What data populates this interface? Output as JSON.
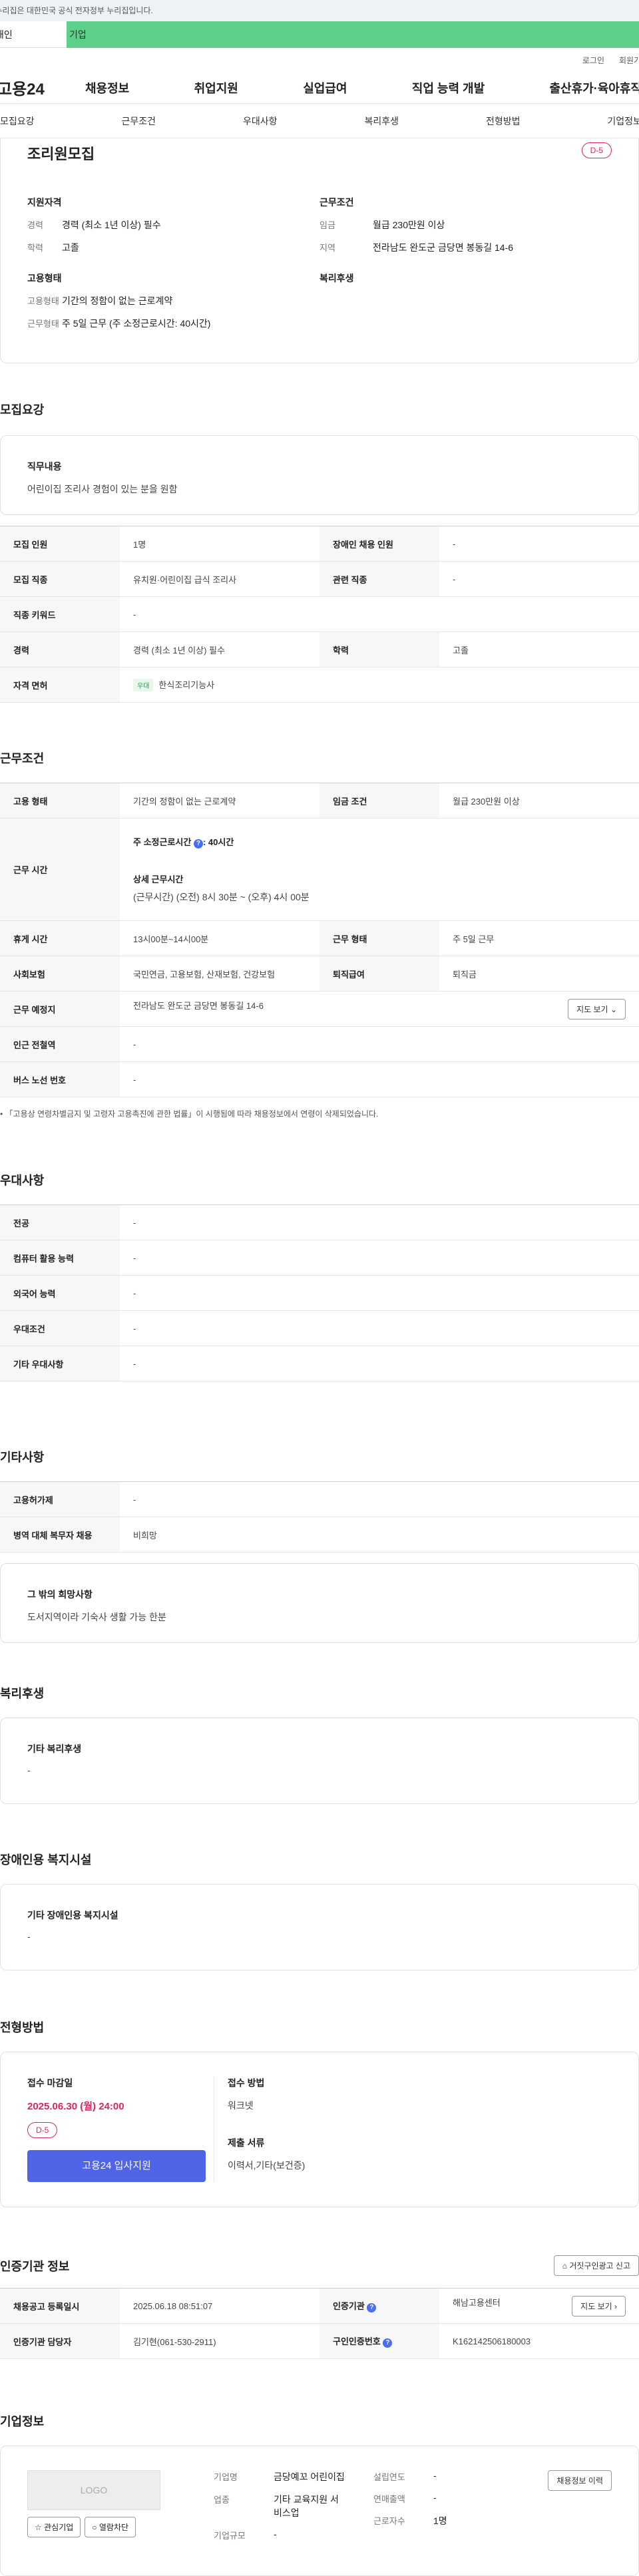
{
  "gov_banner": "이 누리집은 대한민국 공식 전자정부 누리집입니다.",
  "user_tabs": {
    "personal": "개인",
    "company": "기업"
  },
  "util": {
    "login": "로그인",
    "join": "회원가입"
  },
  "gnb": {
    "logo": "고용24",
    "menu": [
      "채용정보",
      "취업지원",
      "실업급여",
      "직업 능력 개발",
      "출산휴가·육아휴직"
    ]
  },
  "subnav": [
    "모집요강",
    "근무조건",
    "우대사항",
    "복리후생",
    "전형방법",
    "기업정보"
  ],
  "summary": {
    "title": "조리원모집",
    "dday": "D-5",
    "qual_title": "지원자격",
    "qual": [
      {
        "k": "경력",
        "v": "경력 (최소 1년 이상) 필수"
      },
      {
        "k": "학력",
        "v": "고졸"
      }
    ],
    "cond_title": "근무조건",
    "cond": [
      {
        "k": "임금",
        "v": "월급 230만원 이상"
      },
      {
        "k": "지역",
        "v": "전라남도 완도군 금당면 봉동길 14-6"
      }
    ],
    "emp_title": "고용형태",
    "emp": [
      {
        "k": "고용형태",
        "v": "기간의 정함이 없는 근로계약"
      },
      {
        "k": "근무형태",
        "v": "주 5일 근무 (주 소정근로시간: 40시간)"
      }
    ],
    "welfare_title": "복리후생"
  },
  "recruit": {
    "title": "모집요강",
    "duty_label": "직무내용",
    "duty_text": "어린이집 조리사 경험이 있는 분을 원함",
    "rows": {
      "headcount_label": "모집 인원",
      "headcount": "1명",
      "disabled_label": "장애인 채용 인원",
      "disabled": "-",
      "job_label": "모집 직종",
      "job": "유치원·어린이집 급식 조리사",
      "related_label": "관련 직종",
      "related": "-",
      "keyword_label": "직종 키워드",
      "keyword": "-",
      "career_label": "경력",
      "career": "경력 (최소 1년 이상) 필수",
      "edu_label": "학력",
      "edu": "고졸",
      "license_label": "자격 면허",
      "license_badge": "우대",
      "license": "한식조리기능사"
    }
  },
  "work": {
    "title": "근무조건",
    "emp_label": "고용 형태",
    "emp": "기간의 정함이 없는 근로계약",
    "wage_label": "임금 조건",
    "wage": "월급 230만원 이상",
    "hours_label": "근무 시간",
    "hours_week": "주 소정근로시간 ",
    "hours_week_val": ": 40시간",
    "hours_detail_title": "상세 근무시간",
    "hours_detail": "(근무시간) (오전) 8시 30분 ~ (오후) 4시 00분",
    "break_label": "휴게 시간",
    "break": "13시00분~14시00분",
    "worktype_label": "근무 형태",
    "worktype": "주 5일 근무",
    "insurance_label": "사회보험",
    "insurance": "국민연금, 고용보험, 산재보험, 건강보험",
    "retire_label": "퇴직급여",
    "retire": "퇴직금",
    "place_label": "근무 예정지",
    "place": "전라남도 완도군 금당면 봉동길 14-6",
    "map_btn": "지도 보기",
    "subway_label": "인근 전철역",
    "subway": "-",
    "bus_label": "버스 노선 번호",
    "bus": "-",
    "note": "「고용상 연령차별금지 및 고령자 고용촉진에 관한 법률」이 시행됨에 따라 채용정보에서 연령이 삭제되었습니다."
  },
  "preference": {
    "title": "우대사항",
    "rows": [
      {
        "k": "전공",
        "v": "-"
      },
      {
        "k": "컴퓨터 활용 능력",
        "v": "-"
      },
      {
        "k": "외국어 능력",
        "v": "-"
      },
      {
        "k": "우대조건",
        "v": "-"
      },
      {
        "k": "기타 우대사항",
        "v": "-"
      }
    ]
  },
  "etc": {
    "title": "기타사항",
    "rows": [
      {
        "k": "고용허가제",
        "v": "-"
      },
      {
        "k": "병역 대체 복무자 채용",
        "v": "비희망"
      }
    ],
    "wish_label": "그 밖의 희망사항",
    "wish_text": "도서지역이라 기숙사 생활 가능 한분"
  },
  "welfare": {
    "title": "복리후생",
    "label": "기타 복리후생",
    "value": "-"
  },
  "facility": {
    "title": "장애인용 복지시설",
    "label": "기타 장애인용 복지시설",
    "value": "-"
  },
  "selection": {
    "title": "전형방법",
    "deadline_label": "접수 마감일",
    "deadline": "2025.06.30 (월) 24:00",
    "dday": "D-5",
    "apply_btn": "고용24 입사지원",
    "method_label": "접수 방법",
    "method": "워크넷",
    "docs_label": "제출 서류",
    "docs": "이력서,기타(보건증)"
  },
  "cert": {
    "title": "인증기관 정보",
    "report_btn": "거짓구인광고 신고",
    "reg_label": "채용공고 등록일시",
    "reg": "2025.06.18 08:51:07",
    "org_label": "인증기관",
    "org": "해남고용센터",
    "map_btn": "지도 보기",
    "manager_label": "인증기관 담당자",
    "manager": "김기현(061-530-2911)",
    "no_label": "구인인증번호",
    "no": "K162142506180003"
  },
  "company": {
    "title": "기업정보",
    "logo_text": "LOGO",
    "fav_btn": "관심기업",
    "block_btn": "열람차단",
    "name_label": "기업명",
    "name": "금당예꼬 어린이집",
    "industry_label": "업종",
    "industry": "기타 교육지원 서비스업",
    "size_label": "기업규모",
    "size": "-",
    "founded_label": "설립연도",
    "founded": "-",
    "sales_label": "연매출액",
    "sales": "-",
    "employees_label": "근로자수",
    "employees": "1명",
    "history_btn": "채용정보 이력"
  }
}
